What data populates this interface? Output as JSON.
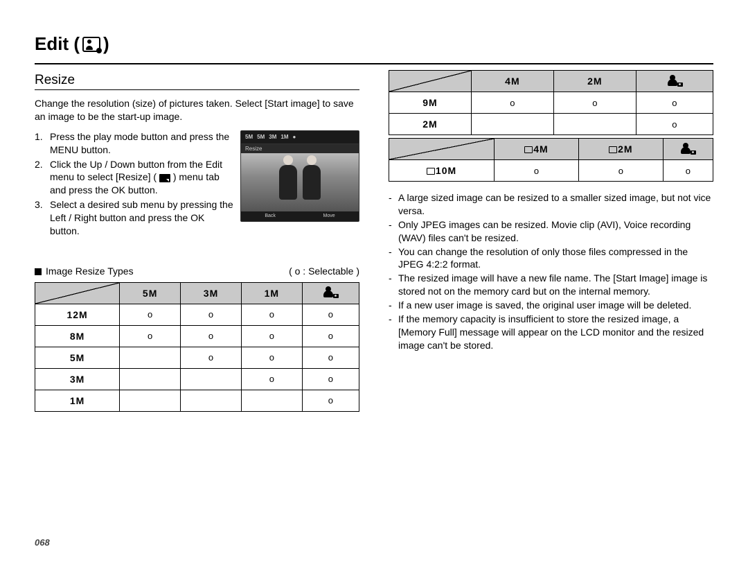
{
  "page_number": "068",
  "title": "Edit (",
  "title_close": ")",
  "section": "Resize",
  "intro": "Change the resolution (size) of pictures taken. Select [Start image] to save an image to be the start-up image.",
  "steps": [
    "Press the play mode button and press the MENU button.",
    "Click the Up / Down button from the Edit menu to select [Resize] (      ) menu tab and press the OK button.",
    "Select a desired sub menu by pressing the Left / Right button and press the OK button."
  ],
  "step2_pre": "Click the Up / Down button from the Edit menu to select [Resize] (",
  "step2_post": ") menu tab and press the OK button.",
  "screenshot": {
    "top_icons": [
      "5M",
      "5M",
      "3M",
      "1M"
    ],
    "label": "Resize",
    "bottom_left": "Back",
    "bottom_right": "Move"
  },
  "legend_left": "Image Resize Types",
  "legend_right": "( o : Selectable )",
  "table1": {
    "cols": [
      "5M",
      "3M",
      "1M",
      "start"
    ],
    "rows": [
      {
        "head": "12M",
        "cells": [
          "o",
          "o",
          "o",
          "o"
        ]
      },
      {
        "head": "8M",
        "cells": [
          "o",
          "o",
          "o",
          "o"
        ]
      },
      {
        "head": "5M",
        "cells": [
          "",
          "o",
          "o",
          "o"
        ]
      },
      {
        "head": "3M",
        "cells": [
          "",
          "",
          "o",
          "o"
        ]
      },
      {
        "head": "1M",
        "cells": [
          "",
          "",
          "",
          "o"
        ]
      }
    ]
  },
  "table2": {
    "cols": [
      "4M",
      "2M",
      "start"
    ],
    "rows": [
      {
        "head": "9M",
        "cells": [
          "o",
          "o",
          "o"
        ]
      },
      {
        "head": "2M",
        "cells": [
          "",
          "",
          "o"
        ]
      }
    ]
  },
  "table3": {
    "cols": [
      "4M",
      "2M",
      "start"
    ],
    "rows": [
      {
        "head": "10M",
        "cells": [
          "o",
          "o",
          "o"
        ]
      }
    ],
    "wide": true
  },
  "notes": [
    "A large sized image can be resized to a smaller sized image, but not vice versa.",
    "Only JPEG images can be resized. Movie clip (AVI), Voice recording (WAV) files can't be resized.",
    "You can change the resolution of only those files compressed in the JPEG 4:2:2 format.",
    "The resized image will have a new file name. The [Start Image] image is stored not on the memory card but on the internal memory.",
    "If a new user image is saved, the original user image will be deleted.",
    "If the memory capacity is insufficient to store the resized image, a [Memory Full] message will appear on the LCD monitor and the resized image can't be stored."
  ]
}
